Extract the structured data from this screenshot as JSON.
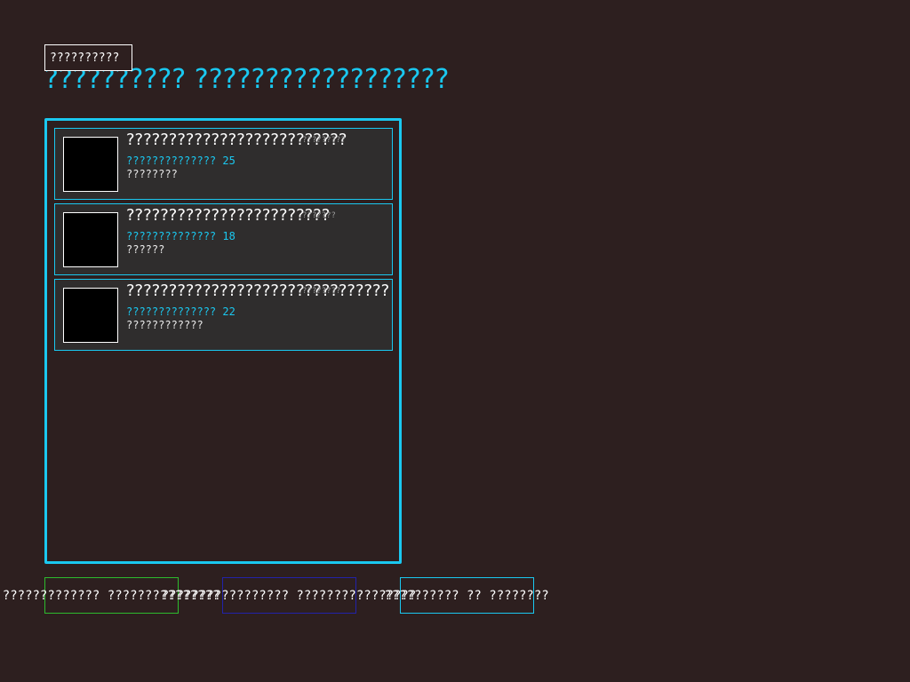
{
  "header": {
    "tag_label": "??????????",
    "title": "?????????? ??????????????????"
  },
  "cards": [
    {
      "title": "??????????????????????????",
      "badge": "?????????",
      "meta": "?????????????? 25",
      "sub": "????????"
    },
    {
      "title": "????????????????????????",
      "badge": "???????",
      "meta": "?????????????? 18",
      "sub": "??????"
    },
    {
      "title": "???????????????????????????????",
      "badge": "????????",
      "meta": "?????????????? 22",
      "sub": "????????????"
    }
  ],
  "buttons": [
    {
      "label": "????????????? ???????????????",
      "border_color": "#2dbb2d"
    },
    {
      "label": "????????????????? ????????????????",
      "border_color": "#2222aa"
    },
    {
      "label": "?????????? ?? ????????",
      "border_color": "#1ac8f0"
    }
  ],
  "colors": {
    "background": "#2d1f1f",
    "accent": "#1ac8f0",
    "card_background": "#2f2d2d"
  }
}
